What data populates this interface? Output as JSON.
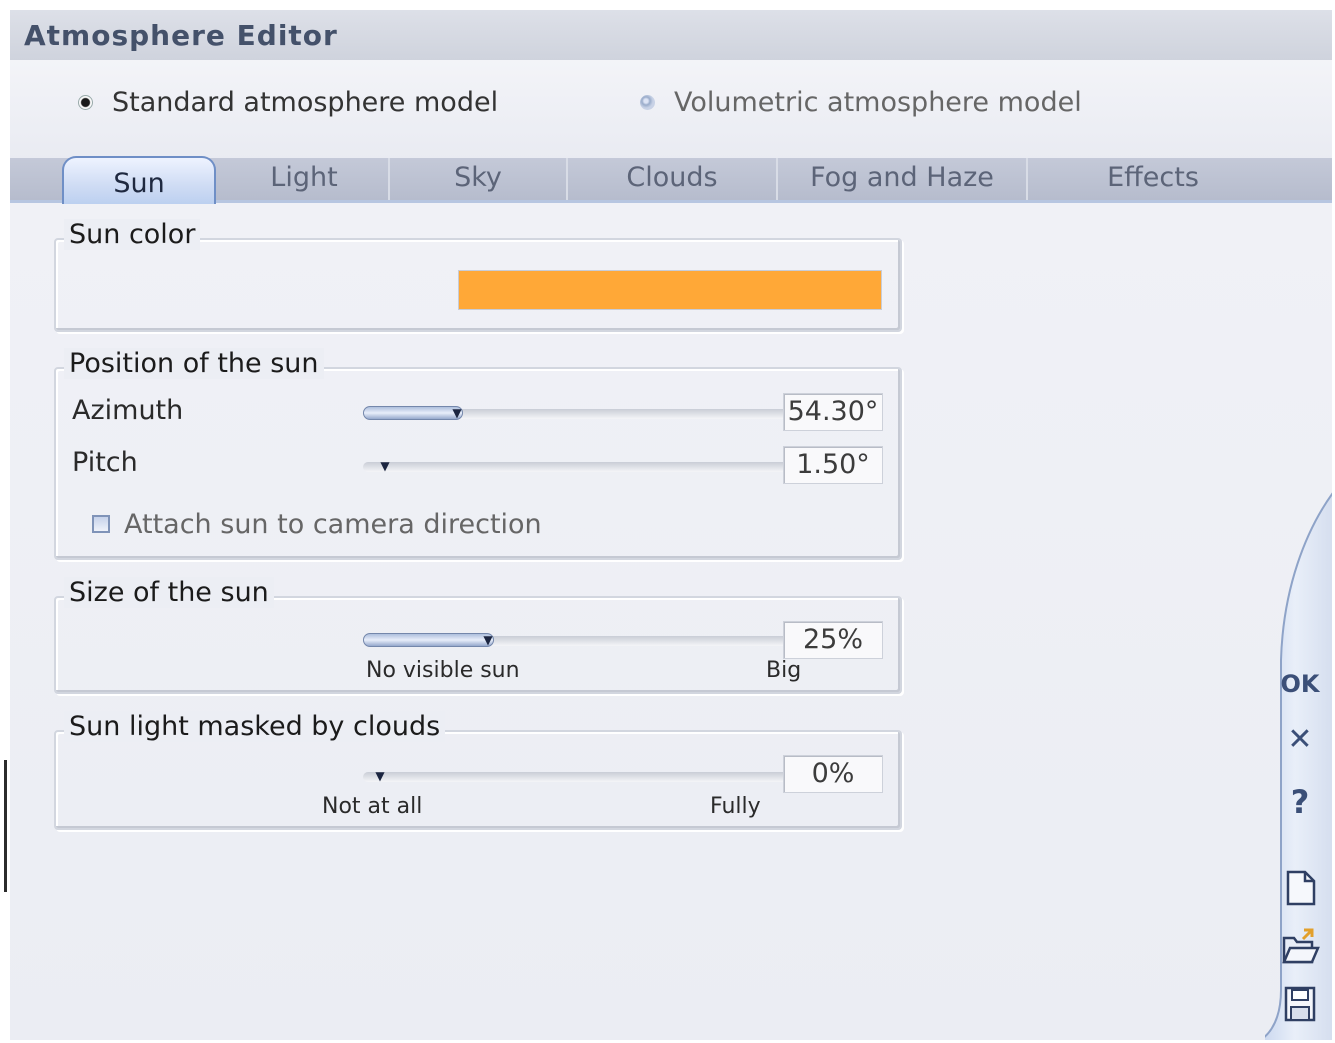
{
  "window": {
    "title": "Atmosphere Editor"
  },
  "models": [
    {
      "label": "Standard atmosphere model",
      "selected": true
    },
    {
      "label": "Volumetric atmosphere model",
      "selected": false
    }
  ],
  "tabs": [
    {
      "label": "Sun",
      "active": true
    },
    {
      "label": "Light",
      "active": false
    },
    {
      "label": "Sky",
      "active": false
    },
    {
      "label": "Clouds",
      "active": false
    },
    {
      "label": "Fog and Haze",
      "active": false
    },
    {
      "label": "Effects",
      "active": false
    }
  ],
  "sun_color": {
    "title": "Sun color",
    "color": "#FFA837"
  },
  "position": {
    "title": "Position of the sun",
    "azimuth": {
      "label": "Azimuth",
      "value": "54.30°",
      "slider_fraction": 0.19
    },
    "pitch": {
      "label": "Pitch",
      "value": "1.50°",
      "slider_fraction": 0.03
    },
    "attach": {
      "label": "Attach sun to camera direction",
      "checked": false
    }
  },
  "size": {
    "title": "Size of the sun",
    "value": "25%",
    "slider_fraction": 0.26,
    "min_label": "No visible sun",
    "max_label": "Big"
  },
  "masked": {
    "title": "Sun light masked by clouds",
    "value": "0%",
    "slider_fraction": 0.02,
    "min_label": "Not at all",
    "max_label": "Fully"
  },
  "side_buttons": {
    "ok": "OK",
    "cancel": "✕",
    "help": "?"
  }
}
